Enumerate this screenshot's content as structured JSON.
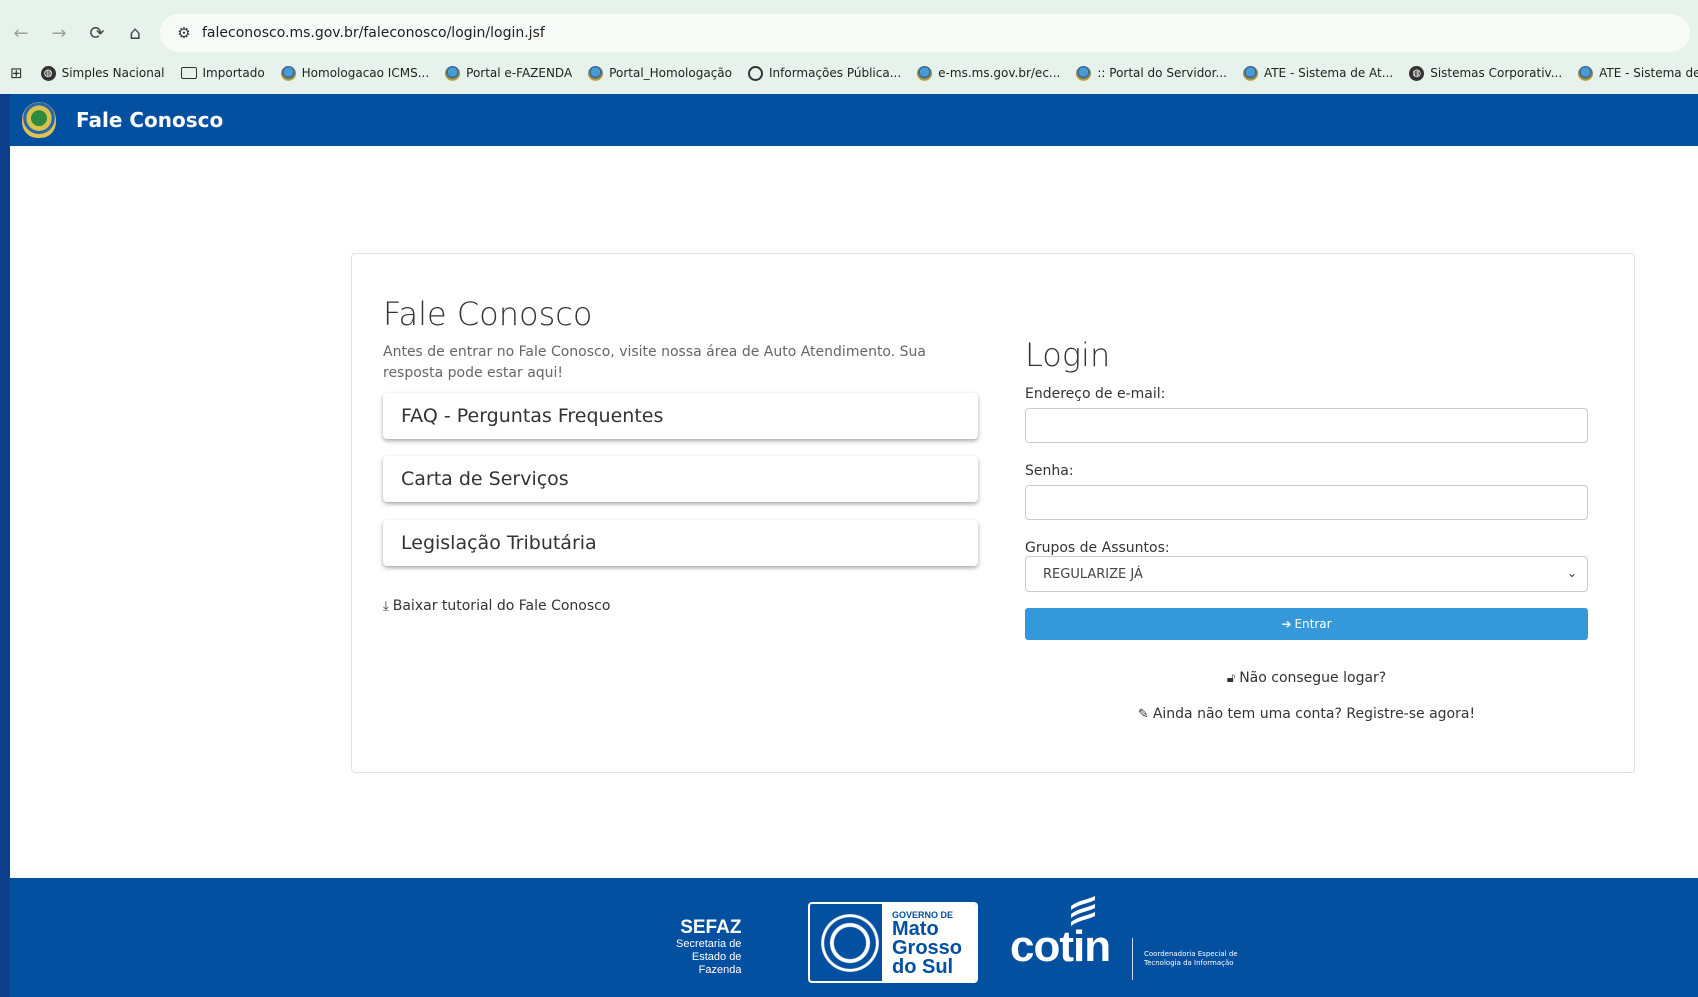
{
  "browser": {
    "url": "faleconosco.ms.gov.br/faleconosco/login/login.jsf",
    "bookmarks": [
      {
        "label": "Simples Nacional",
        "icon": "globe-icon"
      },
      {
        "label": "Importado",
        "icon": "folder-icon"
      },
      {
        "label": "Homologacao ICMS...",
        "icon": "crest-icon"
      },
      {
        "label": "Portal e-FAZENDA",
        "icon": "crest-icon"
      },
      {
        "label": "Portal_Homologação",
        "icon": "crest-icon"
      },
      {
        "label": "Informações Pública...",
        "icon": "power-icon"
      },
      {
        "label": "e-ms.ms.gov.br/ec...",
        "icon": "crest-icon"
      },
      {
        "label": ":: Portal do Servidor...",
        "icon": "crest-icon"
      },
      {
        "label": "ATE - Sistema de At...",
        "icon": "crest-icon"
      },
      {
        "label": "Sistemas Corporativ...",
        "icon": "globe-icon"
      },
      {
        "label": "ATE - Sistema de At...",
        "icon": "crest-icon"
      }
    ]
  },
  "header": {
    "brand": "Fale Conosco"
  },
  "left": {
    "title": "Fale Conosco",
    "description": "Antes de entrar no Fale Conosco, visite nossa área de Auto Atendimento. Sua resposta pode estar aqui!",
    "links": [
      "FAQ - Perguntas Frequentes",
      "Carta de Serviços",
      "Legislação Tributária"
    ],
    "download": "Baixar tutorial do Fale Conosco"
  },
  "login": {
    "title": "Login",
    "email_label": "Endereço de e-mail:",
    "email_value": "",
    "password_label": "Senha:",
    "password_value": "",
    "group_label": "Grupos de Assuntos:",
    "group_selected": "REGULARIZE JÁ",
    "submit": "Entrar",
    "cant_login": "Não consegue logar?",
    "register": "Ainda não tem uma conta? Registre-se agora!"
  },
  "footer": {
    "sefaz_big": "SEFAZ",
    "sefaz_lines": [
      "Secretaria de",
      "Estado de",
      "Fazenda"
    ],
    "gov_small": "GOVERNO DE",
    "gov_lines": [
      "Mato",
      "Grosso",
      "do Sul"
    ],
    "cotin": "cotin",
    "cotin_desc": [
      "Coordenadoria Especial de",
      "Tecnologia da Informação"
    ]
  },
  "colors": {
    "header": "#0350a0",
    "primary_button": "#3498db",
    "outer_frame": "#0b3f8c"
  }
}
